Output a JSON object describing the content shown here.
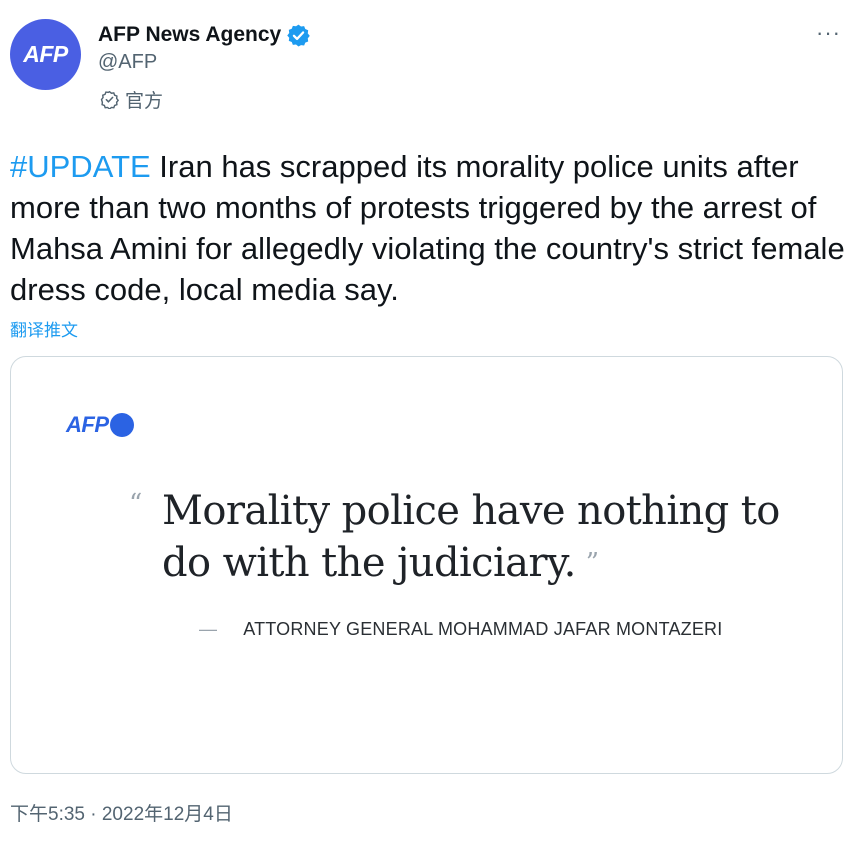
{
  "author": {
    "avatar_text": "AFP",
    "display_name": "AFP News Agency",
    "handle": "@AFP",
    "official_label": "官方",
    "verified_icon": "verified-badge-icon",
    "brand_color": "#4a5fe3"
  },
  "header": {
    "more_label": "···"
  },
  "tweet": {
    "hashtag": "#UPDATE",
    "body": " Iran has scrapped its morality police units after more than two months of protests triggered by the arrest of Mahsa Amini for allegedly violating the country's strict female dress code, local media say.",
    "translate_label": "翻译推文",
    "timestamp": "下午5:35 · 2022年12月4日"
  },
  "media": {
    "logo_text": "AFP",
    "open_quote": "“",
    "quote": "Morality police have nothing to do with the judiciary.",
    "close_quote": "”",
    "attribution_dash": "—",
    "attribution": "ATTORNEY GENERAL MOHAMMAD JAFAR MONTAZERI"
  },
  "colors": {
    "link": "#1d9bf0",
    "secondary_text": "#536471",
    "card_border": "#cfd9de"
  }
}
